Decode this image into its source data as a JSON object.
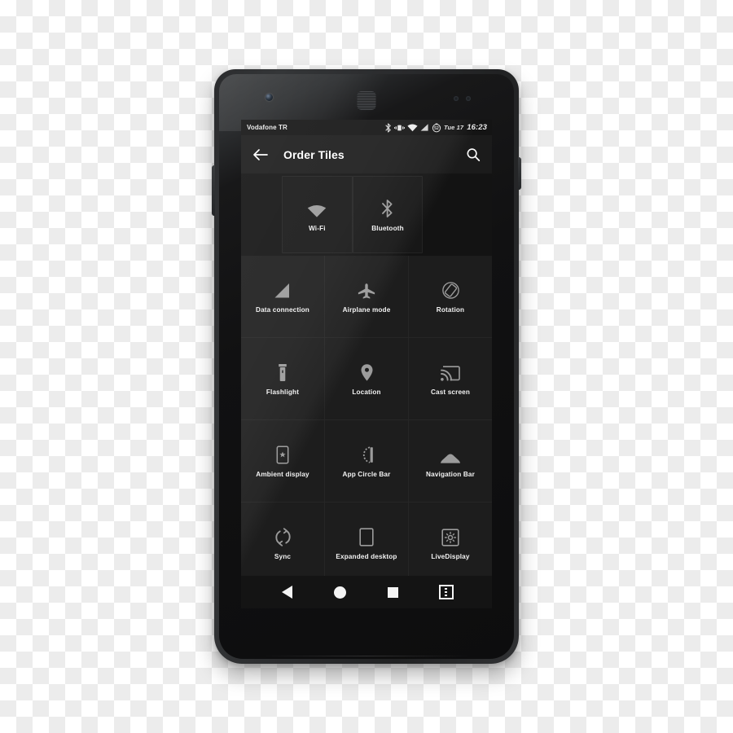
{
  "device": {
    "name": "android-phone-mockup",
    "hardware": {
      "front_camera": "front-camera",
      "earpiece": "earpiece-speaker",
      "sensors": "proximity-sensors",
      "volume_button": "volume-rocker",
      "power_button": "power-button"
    }
  },
  "statusbar": {
    "carrier": "Vodafone TR",
    "icons": [
      "bluetooth-icon",
      "vibrate-icon",
      "wifi-icon",
      "signal-icon",
      "battery-icon"
    ],
    "battery_level": "52",
    "date": "Tue 17",
    "clock": "16:23"
  },
  "toolbar": {
    "back_label": "back-arrow",
    "title": "Order Tiles",
    "search_label": "search"
  },
  "tiles": {
    "drag_row": [
      {
        "label": "Wi-Fi",
        "icon": "wifi-icon"
      },
      {
        "label": "Bluetooth",
        "icon": "bluetooth-icon"
      }
    ],
    "rows": [
      [
        {
          "label": "Data connection",
          "icon": "signal-bars-icon"
        },
        {
          "label": "Airplane mode",
          "icon": "airplane-icon"
        },
        {
          "label": "Rotation",
          "icon": "screen-rotation-icon"
        }
      ],
      [
        {
          "label": "Flashlight",
          "icon": "flashlight-icon"
        },
        {
          "label": "Location",
          "icon": "location-pin-icon"
        },
        {
          "label": "Cast screen",
          "icon": "cast-screen-icon"
        }
      ],
      [
        {
          "label": "Ambient display",
          "icon": "ambient-display-icon"
        },
        {
          "label": "App Circle Bar",
          "icon": "app-circle-bar-icon"
        },
        {
          "label": "Navigation Bar",
          "icon": "navigation-bar-icon"
        }
      ],
      [
        {
          "label": "Sync",
          "icon": "sync-icon"
        },
        {
          "label": "Expanded desktop",
          "icon": "expanded-desktop-icon"
        },
        {
          "label": "LiveDisplay",
          "icon": "livedisplay-icon"
        }
      ]
    ]
  },
  "navbar": {
    "back": "back-button",
    "home": "home-button",
    "recents": "recents-button",
    "menu": "menu-button"
  },
  "colors": {
    "screen_bg": "#131313",
    "tile_bg": "#1d1d1d",
    "tile_border": "#262626",
    "statusbar_bg": "#141414",
    "toolbar_bg": "#1b1b1b",
    "icon_gray": "#9b9b9b",
    "text_white": "#f2f2f2"
  }
}
